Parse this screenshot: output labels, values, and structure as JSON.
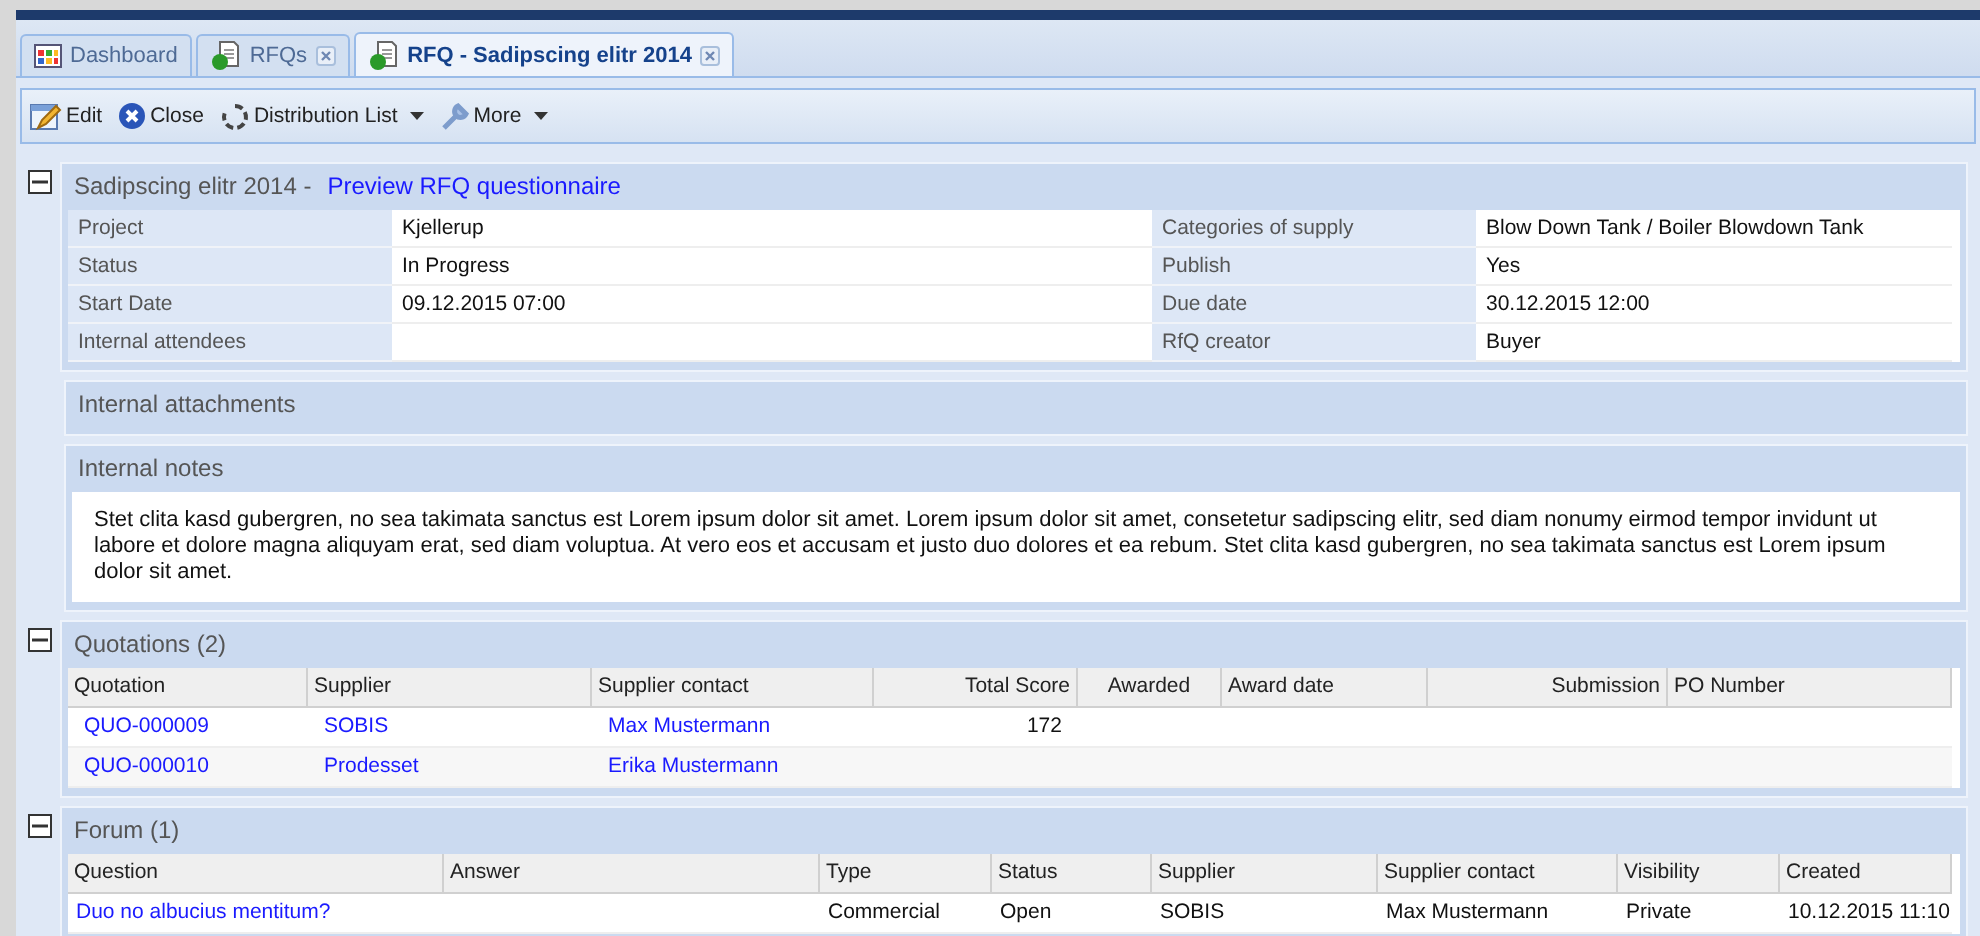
{
  "tabs": [
    {
      "label": "Dashboard",
      "kind": "dashboard",
      "selected": false,
      "closable": false
    },
    {
      "label": "RFQs",
      "kind": "document",
      "selected": false,
      "closable": true
    },
    {
      "label": "RFQ - Sadipscing elitr 2014",
      "kind": "document",
      "selected": true,
      "closable": true
    }
  ],
  "toolbar": [
    {
      "label": "Edit",
      "kind": "button"
    },
    {
      "label": "Close",
      "kind": "button"
    },
    {
      "label": "Distribution List",
      "kind": "menu"
    },
    {
      "label": "More",
      "kind": "menu"
    }
  ],
  "rfq": {
    "title": "Sadipscing elitr 2014 -",
    "link": "Preview RFQ questionnaire",
    "expanded": true,
    "details_left": [
      {
        "label": "Project",
        "value": "Kjellerup"
      },
      {
        "label": "Status",
        "value": "In Progress"
      },
      {
        "label": "Start Date",
        "value": "09.12.2015 07:00"
      },
      {
        "label": "Internal attendees"
      }
    ],
    "details_right": [
      {
        "label": "Categories of supply",
        "value": "Blow Down Tank / Boiler Blowdown Tank"
      },
      {
        "label": "Publish",
        "value": "Yes"
      },
      {
        "label": "Due date",
        "value": "30.12.2015 12:00"
      },
      {
        "label": "RfQ creator",
        "value": "Buyer"
      }
    ],
    "attachments": {
      "title": "Internal attachments"
    },
    "notes": {
      "title": "Internal notes",
      "text": "Stet clita kasd gubergren, no sea takimata sanctus est Lorem ipsum dolor sit amet. Lorem ipsum dolor sit amet, consetetur sadipscing elitr, sed diam nonumy eirmod tempor invidunt ut labore et dolore magna aliquyam erat, sed diam voluptua. At vero eos et accusam et justo duo dolores et ea rebum. Stet clita kasd gubergren, no sea takimata sanctus est Lorem ipsum dolor sit amet."
    }
  },
  "quotations": {
    "title": "Quotations (2)",
    "expanded": true,
    "columns": [
      {
        "label": "Quotation",
        "kind": "link"
      },
      {
        "label": "Supplier",
        "kind": "link"
      },
      {
        "label": "Supplier contact",
        "kind": "link"
      },
      {
        "label": "Total Score",
        "kind": "text"
      },
      {
        "label": "Awarded",
        "kind": "text"
      },
      {
        "label": "Award date",
        "kind": "text"
      },
      {
        "label": "Submission",
        "kind": "text"
      },
      {
        "label": "PO Number",
        "kind": "text"
      }
    ],
    "rows": [
      {
        "cells": [
          "QUO-000009",
          "SOBIS",
          "Max Mustermann",
          "172",
          null,
          null,
          null,
          null
        ]
      },
      {
        "cells": [
          "QUO-000010",
          "Prodesset",
          "Erika Mustermann",
          null,
          null,
          null,
          null,
          null
        ]
      }
    ]
  },
  "forum": {
    "title": "Forum (1)",
    "expanded": true,
    "columns": [
      {
        "label": "Question",
        "kind": "link"
      },
      {
        "label": "Answer",
        "kind": "text"
      },
      {
        "label": "Type",
        "kind": "text"
      },
      {
        "label": "Status",
        "kind": "text"
      },
      {
        "label": "Supplier",
        "kind": "text"
      },
      {
        "label": "Supplier contact",
        "kind": "text"
      },
      {
        "label": "Visibility",
        "kind": "text"
      },
      {
        "label": "Created",
        "kind": "text"
      }
    ],
    "rows": [
      {
        "cells": [
          "Duo no albucius mentitum?",
          null,
          "Commercial",
          "Open",
          "SOBIS",
          "Max Mustermann",
          "Private",
          "10.12.2015 11:10"
        ]
      }
    ]
  }
}
